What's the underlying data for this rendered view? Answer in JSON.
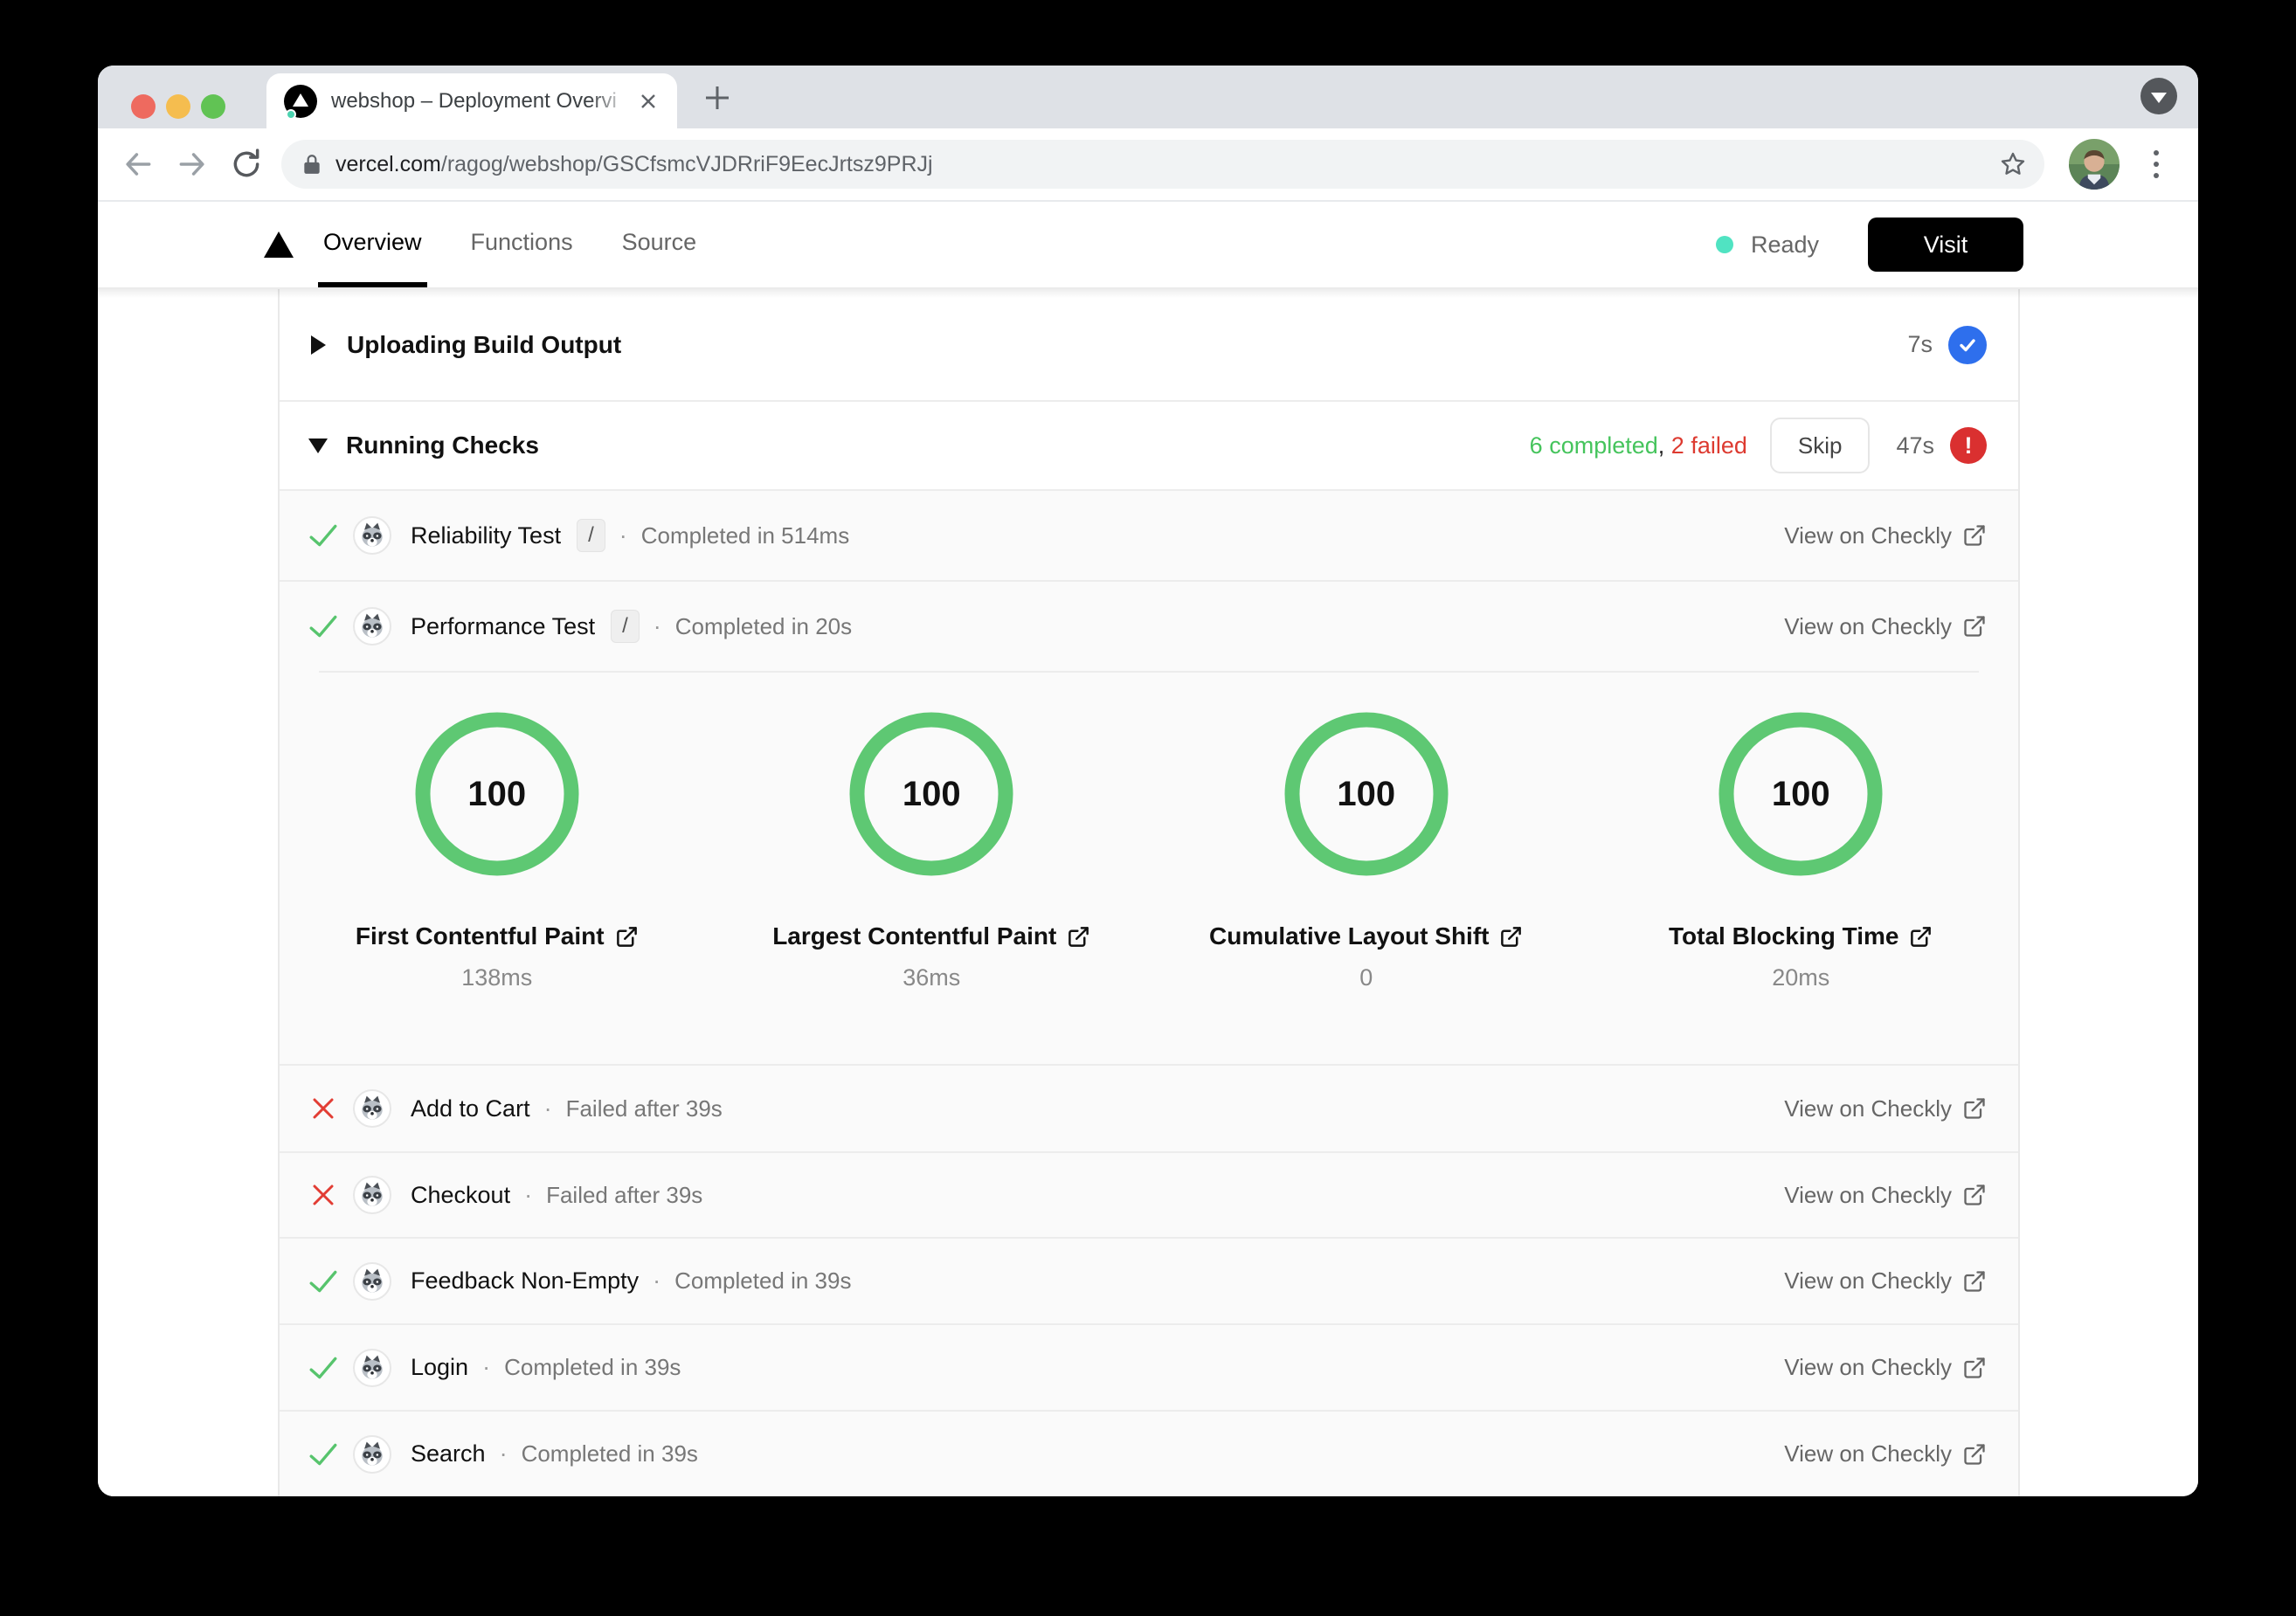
{
  "browser": {
    "tab": {
      "title": "webshop – Deployment Overvi"
    },
    "url": {
      "domain": "vercel.com",
      "path": "/ragog/webshop/GSCfsmcVJDRriF9EecJrtsz9PRJj"
    }
  },
  "nav": {
    "tabs": [
      {
        "label": "Overview",
        "active": true
      },
      {
        "label": "Functions",
        "active": false
      },
      {
        "label": "Source",
        "active": false
      }
    ],
    "status": {
      "label": "Ready",
      "color": "#50e3c2"
    },
    "visit_label": "Visit"
  },
  "build": {
    "uploading": {
      "title": "Uploading Build Output",
      "duration": "7s"
    },
    "running_checks": {
      "title": "Running Checks",
      "completed_text": "6 completed",
      "comma": ",",
      "failed_text": "2 failed",
      "skip_label": "Skip",
      "duration": "47s",
      "alert_glyph": "!"
    }
  },
  "checks": {
    "view_label": "View on Checkly",
    "dot": "·",
    "rows": [
      {
        "name": "Reliability Test",
        "badge": "/",
        "meta": "Completed in 514ms",
        "status": "completed"
      },
      {
        "name": "Performance Test",
        "badge": "/",
        "meta": "Completed in 20s",
        "status": "completed"
      },
      {
        "name": "Add to Cart",
        "meta": "Failed after 39s",
        "status": "failed"
      },
      {
        "name": "Checkout",
        "meta": "Failed after 39s",
        "status": "failed"
      },
      {
        "name": "Feedback Non-Empty",
        "meta": "Completed in 39s",
        "status": "completed"
      },
      {
        "name": "Login",
        "meta": "Completed in 39s",
        "status": "completed"
      },
      {
        "name": "Search",
        "meta": "Completed in 39s",
        "status": "completed"
      }
    ]
  },
  "performance": {
    "metrics": [
      {
        "score": "100",
        "label": "First Contentful Paint",
        "value": "138ms"
      },
      {
        "score": "100",
        "label": "Largest Contentful Paint",
        "value": "36ms"
      },
      {
        "score": "100",
        "label": "Cumulative Layout Shift",
        "value": "0"
      },
      {
        "score": "100",
        "label": "Total Blocking Time",
        "value": "20ms"
      }
    ]
  },
  "colors": {
    "ready_teal": "#50e3c2",
    "ring_green": "#5ec873",
    "check_green": "#57c46d",
    "completed_text_green": "#45c45c",
    "failed_text_red": "#dd3a30",
    "fail_x_red": "#e23d34",
    "badge_blue": "#2e6fed",
    "badge_red": "#da3030",
    "visit_button_black": "#000000"
  }
}
